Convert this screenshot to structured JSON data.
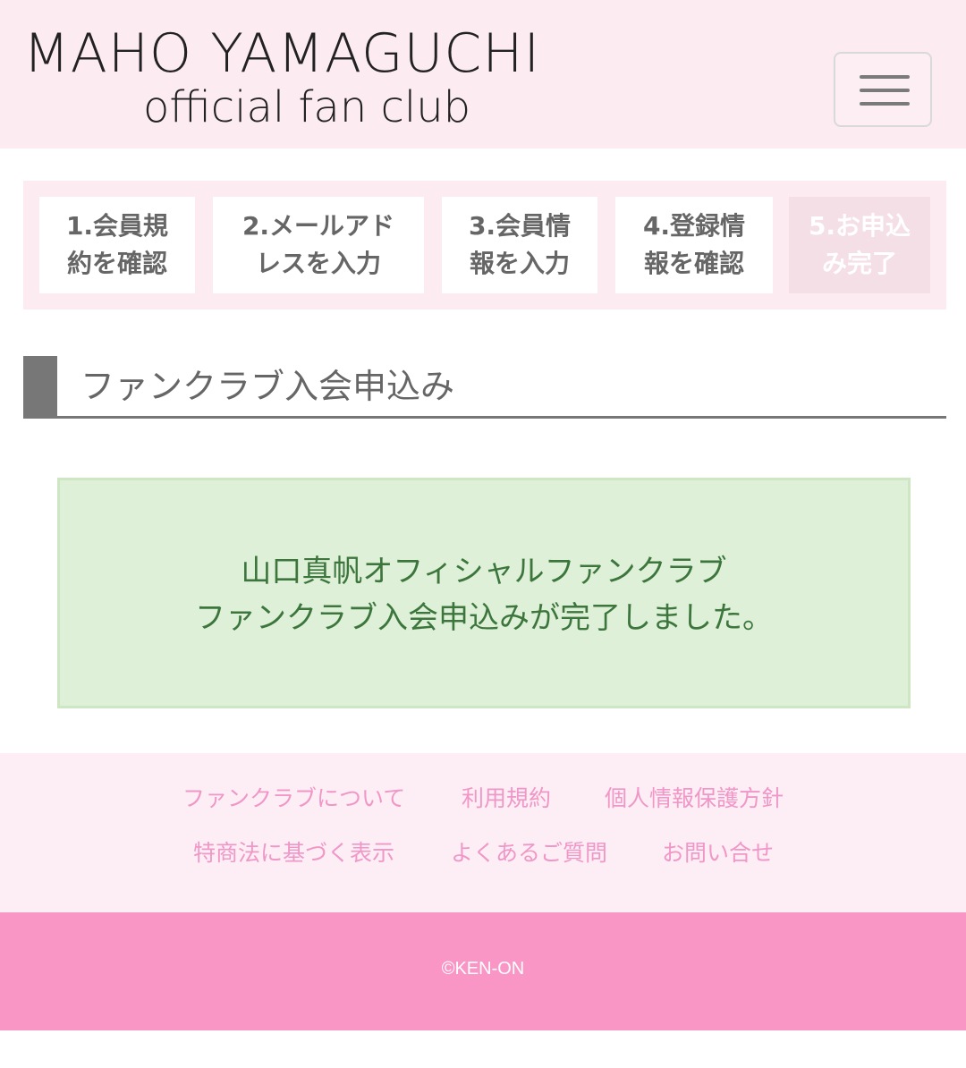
{
  "header": {
    "logo_line1": "MAHO YAMAGUCHI",
    "logo_line2": "official fan club",
    "menu_icon": "hamburger-menu-icon"
  },
  "steps": [
    {
      "line1": "1.会員規",
      "line2": "約を確認",
      "active": false
    },
    {
      "line1": "2.メールアド",
      "line2": "レスを入力",
      "active": false
    },
    {
      "line1": "3.会員情",
      "line2": "報を入力",
      "active": false
    },
    {
      "line1": "4.登録情",
      "line2": "報を確認",
      "active": false
    },
    {
      "line1": "5.お申込",
      "line2": "み完了",
      "active": true
    }
  ],
  "page": {
    "heading": "ファンクラブ入会申込み"
  },
  "success": {
    "line1": "山口真帆オフィシャルファンクラブ",
    "line2": "ファンクラブ入会申込みが完了しました。"
  },
  "footer": {
    "links": [
      "ファンクラブについて",
      "利用規約",
      "個人情報保護方針",
      "特商法に基づく表示",
      "よくあるご質問",
      "お問い合せ"
    ],
    "copyright": "©KEN-ON"
  },
  "colors": {
    "header_bg": "#fdebf2",
    "success_bg": "#dff0d8",
    "success_text": "#3c763d",
    "footer_link": "#f097c8",
    "copyright_bg": "#f996c6"
  }
}
